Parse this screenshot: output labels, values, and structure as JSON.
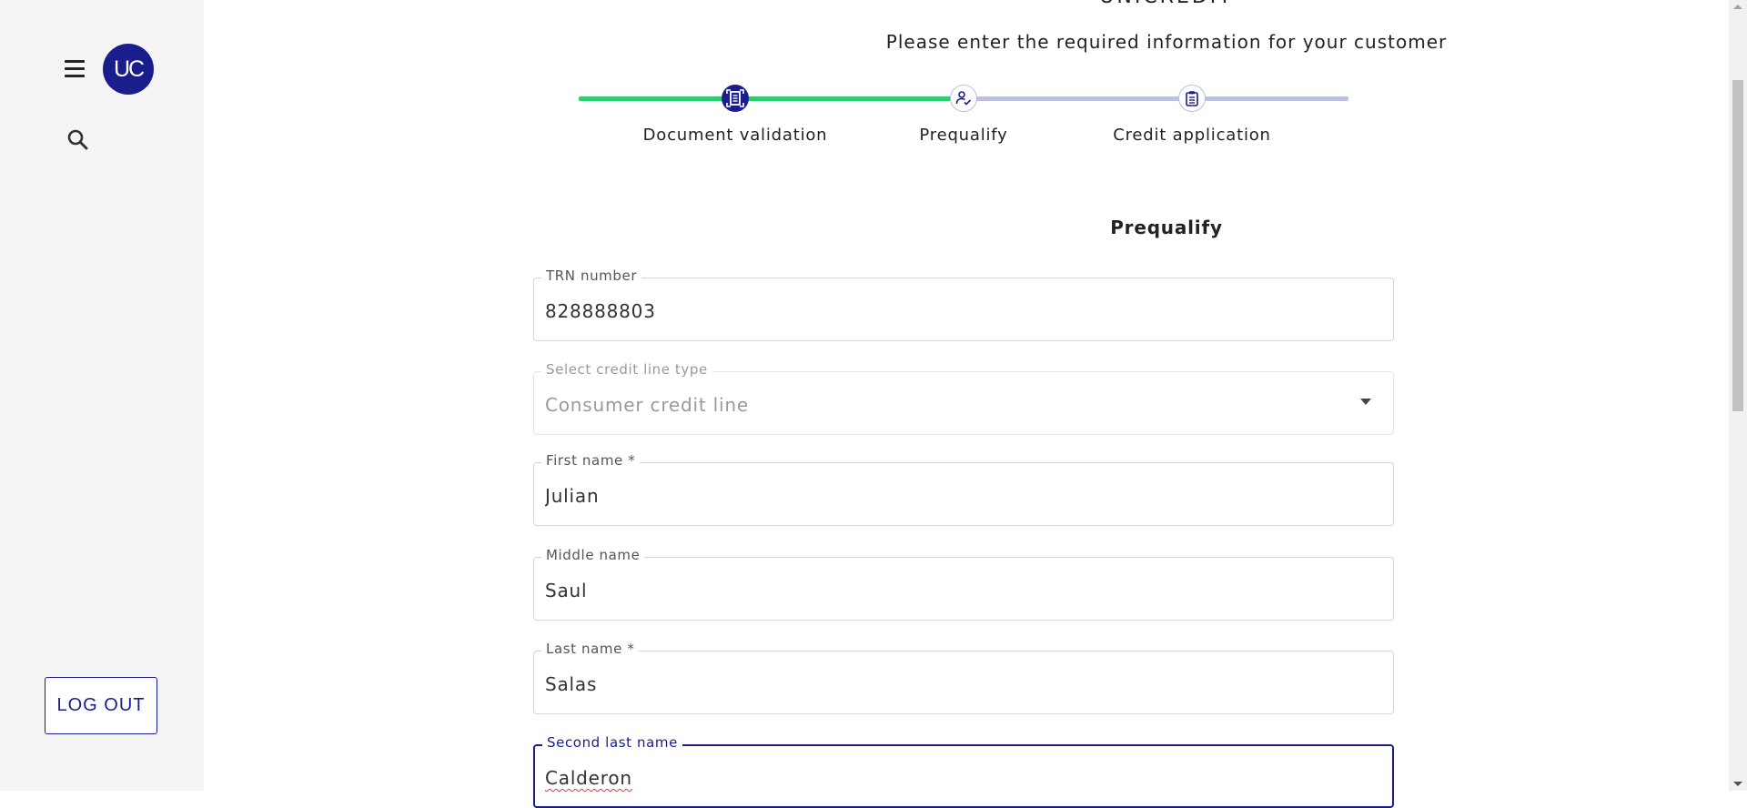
{
  "sidebar": {
    "avatar_initials": "UC",
    "menu_icon": "hamburger-menu-icon",
    "search_icon": "search-icon",
    "logout_label": "LOG OUT"
  },
  "header": {
    "brand": "UNICREDIT",
    "subtitle": "Please enter the required information for your customer"
  },
  "stepper": {
    "completed_color": "#2ecc71",
    "pending_color": "#bcbfe0",
    "active_color": "#1a1e8c",
    "steps": [
      {
        "label": "Document validation",
        "icon": "document-scan-icon",
        "state": "active"
      },
      {
        "label": "Prequalify",
        "icon": "person-check-icon",
        "state": "current"
      },
      {
        "label": "Credit application",
        "icon": "clipboard-icon",
        "state": "pending"
      }
    ]
  },
  "form": {
    "title": "Prequalify",
    "trn": {
      "label": "TRN number",
      "value": "828888803"
    },
    "credit_line": {
      "label": "Select credit line type",
      "value": "Consumer credit line"
    },
    "first_name": {
      "label": "First name *",
      "value": "Julian"
    },
    "middle_name": {
      "label": "Middle name",
      "value": "Saul"
    },
    "last_name": {
      "label": "Last name *",
      "value": "Salas"
    },
    "second_last_name": {
      "label": "Second last name",
      "value": "Calderon"
    }
  }
}
